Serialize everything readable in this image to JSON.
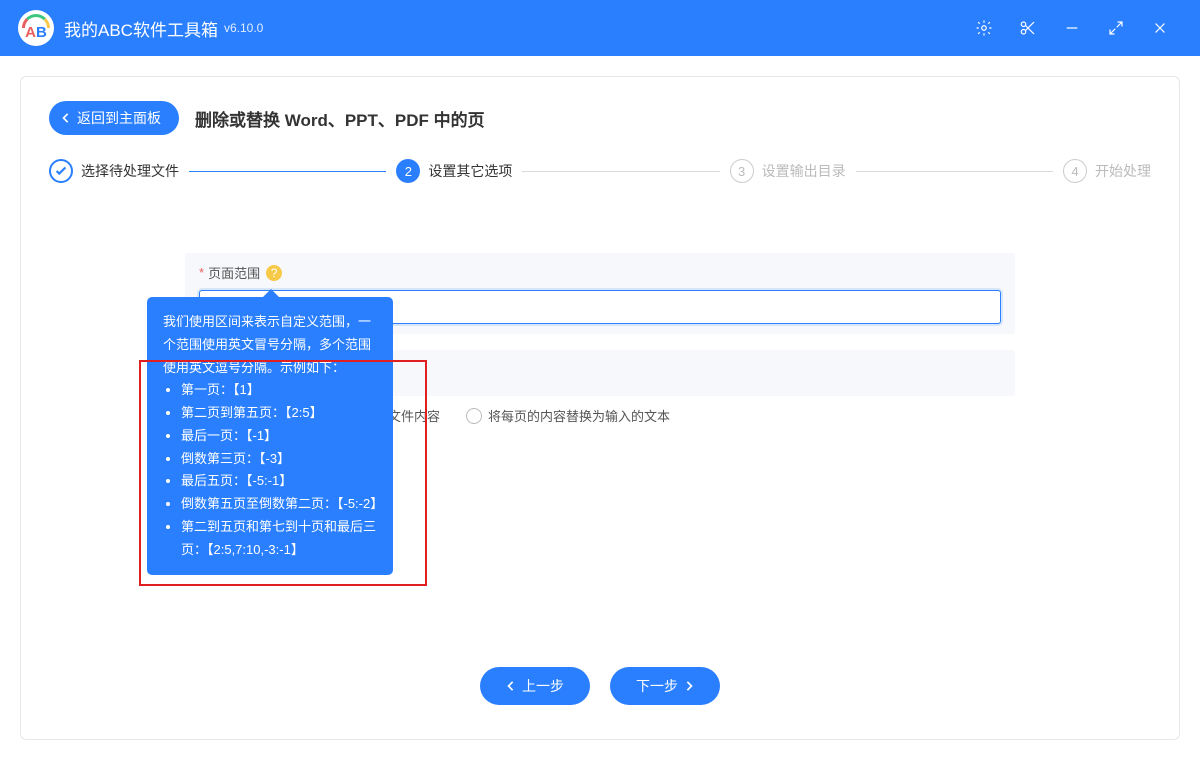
{
  "titlebar": {
    "appName": "我的ABC软件工具箱",
    "version": "v6.10.0"
  },
  "page": {
    "backLabel": "返回到主面板",
    "title": "删除或替换 Word、PPT、PDF 中的页"
  },
  "steps": [
    {
      "label": "选择待处理文件"
    },
    {
      "label": "设置其它选项"
    },
    {
      "label": "设置输出目录"
    },
    {
      "label": "开始处理"
    }
  ],
  "form": {
    "pageRange": {
      "label": "页面范围",
      "required": "*",
      "value": ""
    },
    "tooltip": {
      "intro": "我们使用区间来表示自定义范围，一个范围使用英文冒号分隔，多个范围使用英文逗号分隔。示例如下：",
      "items": [
        "第一页：【1】",
        "第二页到第五页：【2:5】",
        "最后一页：【-1】",
        "倒数第三页：【-3】",
        "最后五页：【-5:-1】",
        "倒数第五页至倒数第二页：【-5:-2】",
        "第二到五页和第七到十页和最后三页：【2:5,7:10,-3:-1】"
      ]
    },
    "radios": {
      "opt1": "的文件内容",
      "opt2": "将每页的内容替换为输入的文本"
    }
  },
  "footer": {
    "prev": "上一步",
    "next": "下一步"
  }
}
